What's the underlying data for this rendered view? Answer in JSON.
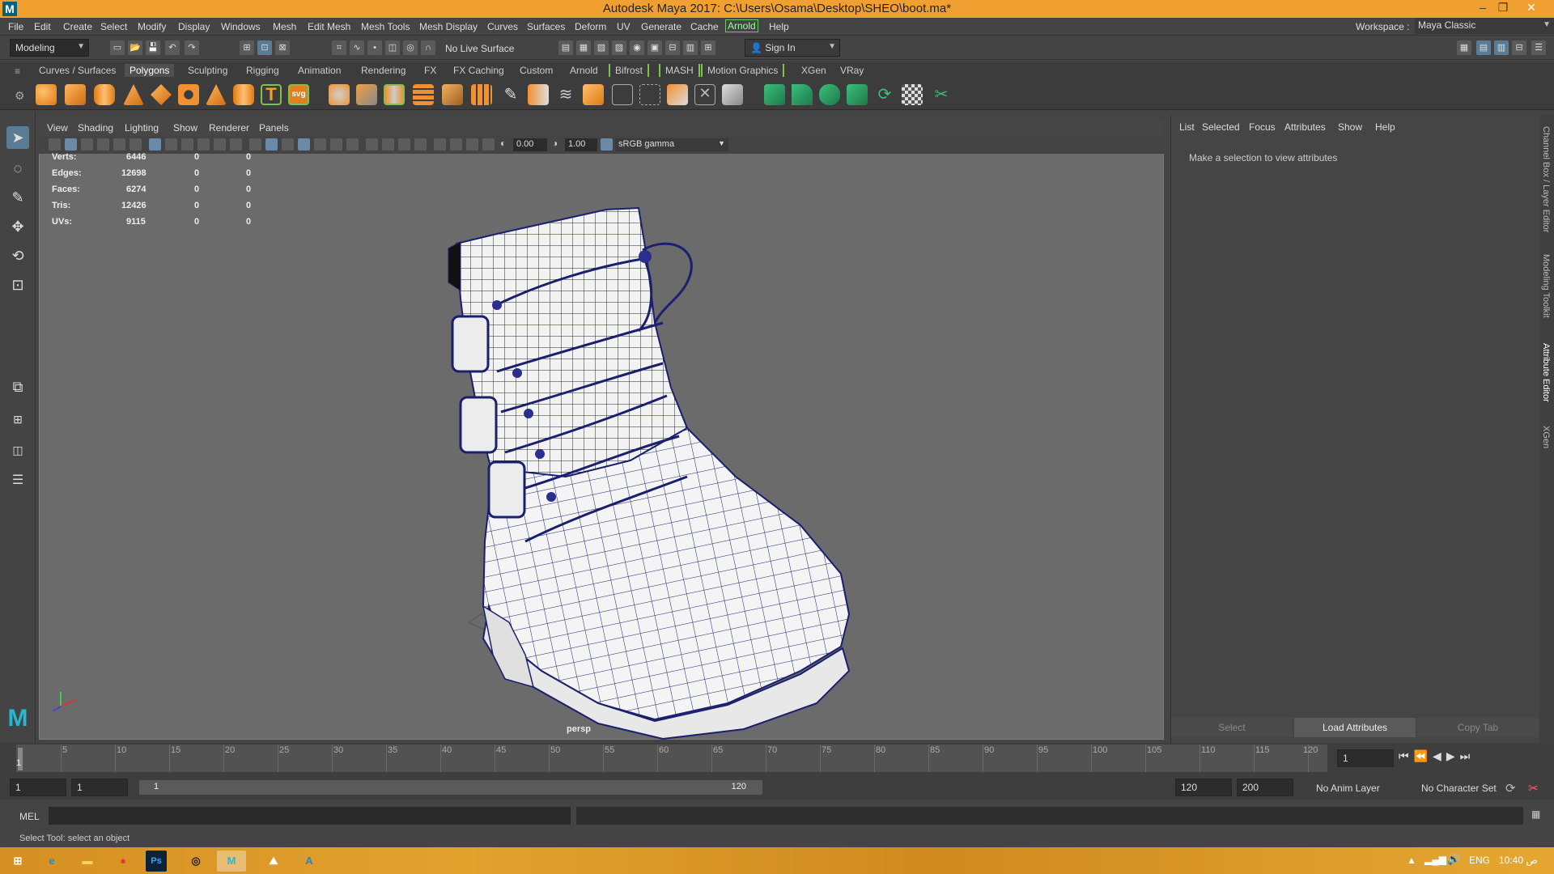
{
  "window": {
    "title": "Autodesk Maya 2017: C:\\Users\\Osama\\Desktop\\SHEO\\boot.ma*",
    "logo_text": "M",
    "minimize": "–",
    "restore": "❐",
    "close": "✕"
  },
  "menubar": {
    "items": [
      "File",
      "Edit",
      "Create",
      "Select",
      "Modify",
      "Display",
      "Windows",
      "Mesh",
      "Edit Mesh",
      "Mesh Tools",
      "Mesh Display",
      "Curves",
      "Surfaces",
      "Deform",
      "UV",
      "Generate",
      "Cache",
      "Arnold",
      "Help"
    ],
    "workspace_label": "Workspace :",
    "workspace_value": "Maya Classic"
  },
  "statusline": {
    "menuset": "Modeling",
    "live_surface": "No Live Surface",
    "sign_in": "Sign In"
  },
  "shelf": {
    "tabs": [
      "Curves / Surfaces",
      "Polygons",
      "Sculpting",
      "Rigging",
      "Animation",
      "Rendering",
      "FX",
      "FX Caching",
      "Custom",
      "Arnold",
      "Bifrost",
      "MASH",
      "Motion Graphics",
      "XGen",
      "VRay"
    ],
    "active_tab": "Polygons"
  },
  "viewport": {
    "menu": [
      "View",
      "Shading",
      "Lighting",
      "Show",
      "Renderer",
      "Panels"
    ],
    "exposure": "0.00",
    "gamma": "1.00",
    "colorspace": "sRGB gamma",
    "camera_label": "persp",
    "hud": [
      {
        "label": "Verts:",
        "v1": "6446",
        "v2": "0",
        "v3": "0"
      },
      {
        "label": "Edges:",
        "v1": "12698",
        "v2": "0",
        "v3": "0"
      },
      {
        "label": "Faces:",
        "v1": "6274",
        "v2": "0",
        "v3": "0"
      },
      {
        "label": "Tris:",
        "v1": "12426",
        "v2": "0",
        "v3": "0"
      },
      {
        "label": "UVs:",
        "v1": "9115",
        "v2": "0",
        "v3": "0"
      }
    ]
  },
  "attribute_editor": {
    "menu": [
      "List",
      "Selected",
      "Focus",
      "Attributes",
      "Show",
      "Help"
    ],
    "message": "Make a selection to view attributes",
    "buttons": {
      "select": "Select",
      "load": "Load Attributes",
      "copy": "Copy Tab"
    },
    "side_tabs": [
      "Channel Box / Layer Editor",
      "Modeling Toolkit",
      "Attribute Editor",
      "XGen"
    ]
  },
  "timeline": {
    "ticks": [
      "5",
      "10",
      "15",
      "20",
      "25",
      "30",
      "35",
      "40",
      "45",
      "50",
      "55",
      "60",
      "65",
      "70",
      "75",
      "80",
      "85",
      "90",
      "95",
      "100",
      "105",
      "110",
      "115",
      "120"
    ],
    "start_marker": "1",
    "current_frame": "1",
    "range_start": "1",
    "range_inner_start": "1",
    "range_slider_start": "1",
    "range_slider_end": "120",
    "range_end": "120",
    "anim_end": "200",
    "anim_layer": "No Anim Layer",
    "character_set": "No Character Set"
  },
  "command": {
    "mel_label": "MEL",
    "help_text": "Select Tool: select an object"
  },
  "taskbar": {
    "language": "ENG",
    "time": "10:40 ص"
  }
}
